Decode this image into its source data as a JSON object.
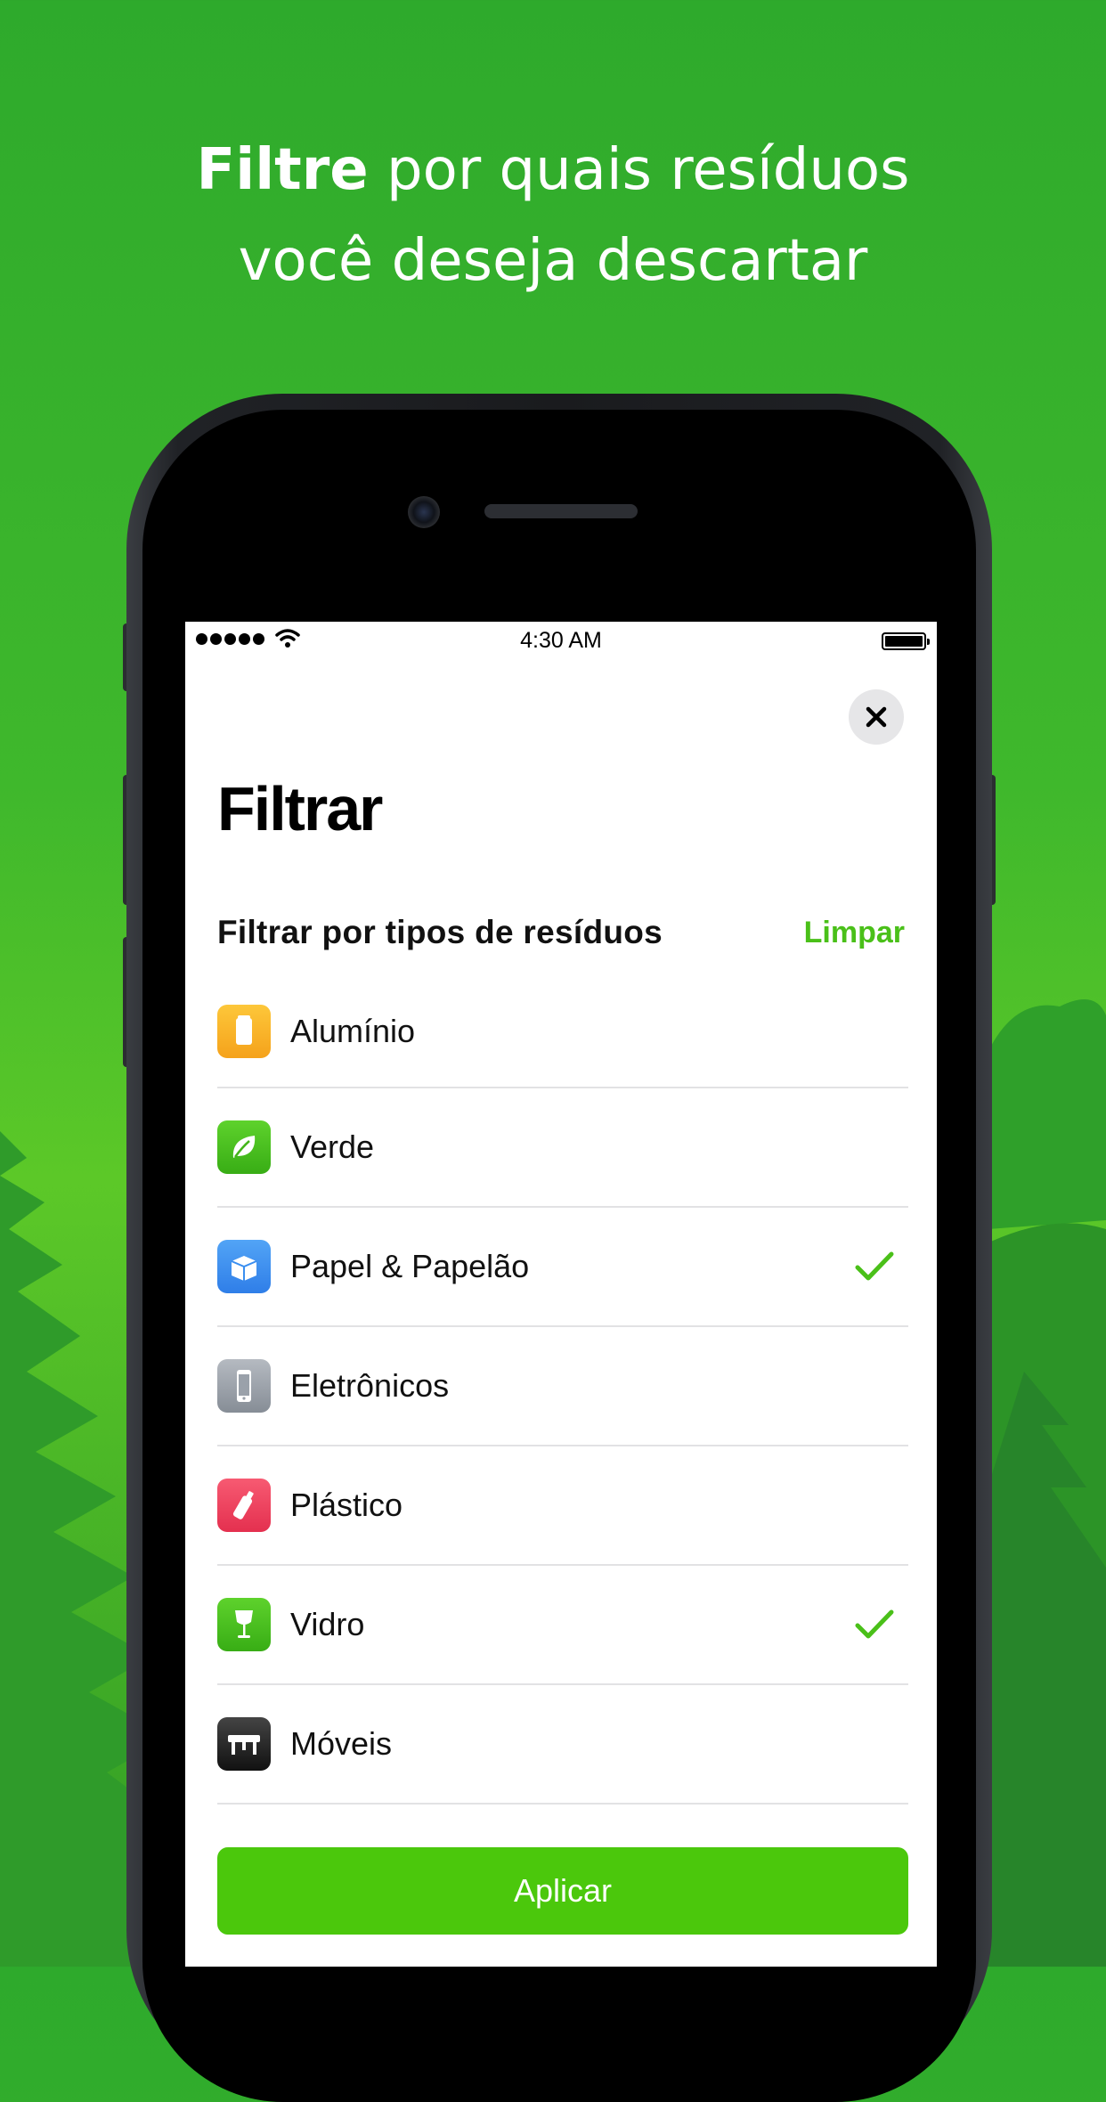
{
  "headline": {
    "bold": "Filtre",
    "rest_line1": " por quais resíduos",
    "line2": "você deseja descartar"
  },
  "status_bar": {
    "time": "4:30 AM"
  },
  "filter": {
    "title": "Filtrar",
    "section_label": "Filtrar por tipos de resíduos",
    "clear_label": "Limpar",
    "items": [
      {
        "label": "Alumínio",
        "icon": "aluminum-can-icon",
        "color": "#fbb324",
        "checked": false
      },
      {
        "label": "Verde",
        "icon": "leaf-icon",
        "color": "#4cc01e",
        "checked": false
      },
      {
        "label": "Papel & Papelão",
        "icon": "box-icon",
        "color": "#3d8ef0",
        "checked": true
      },
      {
        "label": "Eletrônicos",
        "icon": "phone-icon",
        "color": "#9aa1aa",
        "checked": false
      },
      {
        "label": "Plástico",
        "icon": "bottle-icon",
        "color": "#f0405e",
        "checked": false
      },
      {
        "label": "Vidro",
        "icon": "wine-glass-icon",
        "color": "#4cc01e",
        "checked": true
      },
      {
        "label": "Móveis",
        "icon": "table-icon",
        "color": "#2a2a2a",
        "checked": false
      }
    ],
    "apply_label": "Aplicar"
  },
  "colors": {
    "accent": "#4bc80c",
    "check": "#4ac019",
    "background": "#3fb82c"
  }
}
